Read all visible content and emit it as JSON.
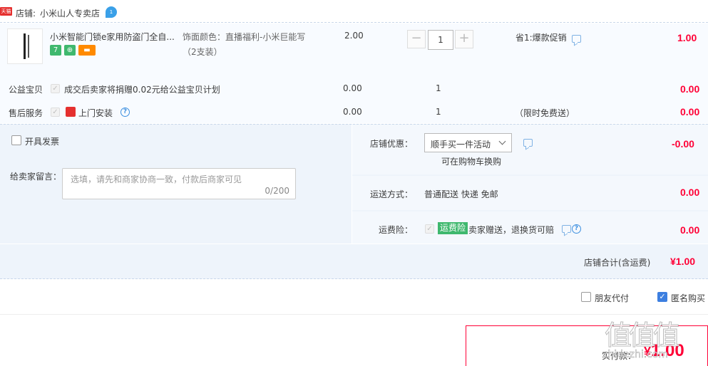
{
  "shop": {
    "badge": "天猫",
    "label": "店铺:",
    "name": "小米山人专卖店",
    "ww_badge": "1"
  },
  "item": {
    "title": "小米智能门锁e家用防盗门全自...",
    "tags": [
      {
        "text": "7",
        "color": "#3fb86e"
      },
      {
        "text": "⊕",
        "color": "#3fb86e"
      },
      {
        "text": "▬",
        "color": "#ff8a00"
      }
    ],
    "sku_line1": "饰面颜色：直播福利-小米巨能写",
    "sku_line2": "（2支装）",
    "unit_price": "2.00",
    "quantity": "1",
    "promo": "省1:爆款促销",
    "subtotal": "1.00"
  },
  "charity": {
    "label": "公益宝贝",
    "text": "成交后卖家将捐赠0.02元给公益宝贝计划",
    "price": "0.00",
    "qty": "1",
    "subtotal": "0.00"
  },
  "service": {
    "label": "售后服务",
    "text": "上门安装",
    "help": "?",
    "price": "0.00",
    "qty": "1",
    "note": "（限时免费送）",
    "subtotal": "0.00"
  },
  "invoice": {
    "label": "开具发票"
  },
  "seller_message": {
    "label": "给卖家留言：",
    "placeholder": "选填，请先和商家协商一致，付款后商家可见",
    "counter": "0/200"
  },
  "shop_discount": {
    "label": "店铺优惠：",
    "selected": "顺手买一件活动",
    "hint": "可在购物车换购",
    "amount": "-0.00"
  },
  "shipping": {
    "label": "运送方式：",
    "value": "普通配送 快递 免邮",
    "amount": "0.00"
  },
  "freight_insurance": {
    "label": "运费险：",
    "badge": "运费险",
    "text": "卖家赠送，退换货可赔",
    "amount": "0.00"
  },
  "shop_total": {
    "label": "店铺合计(含运费)",
    "amount": "¥1.00"
  },
  "options": {
    "friend_pay": "朋友代付",
    "anonymous": "匿名购买"
  },
  "payment": {
    "label": "实付款：",
    "currency": "¥",
    "amount": "1.00"
  },
  "colors": {
    "price_red": "#ff0036",
    "accent_blue": "#3d7fe0",
    "panel_bg": "#eef4fb"
  },
  "watermark": {
    "logo": "值值值",
    "site": "zhidezhi.com"
  }
}
